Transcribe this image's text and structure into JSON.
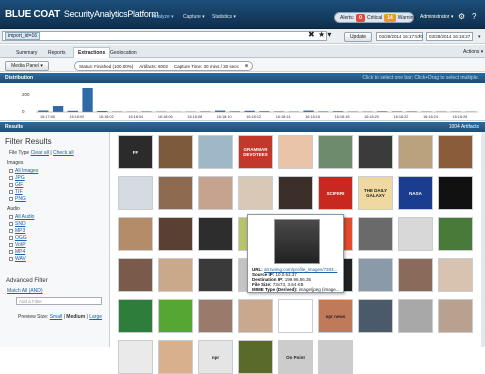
{
  "header": {
    "brand": "BLUE COAT",
    "product": "SecurityAnalyticsPlatform",
    "nav": [
      "Analyze ▾",
      "Capture ▾",
      "Statistics ▾"
    ],
    "alerts_label": "Alerts:",
    "critical_count": "0",
    "critical_label": "Critical",
    "warning_count": "14",
    "warning_label": "Warning",
    "user": "Administrator ▾",
    "critical_color": "#d94d3a",
    "warning_color": "#e79a2a"
  },
  "query": {
    "token": "import_id=16",
    "clear": "✖",
    "star": "★ ▾",
    "update_label": "Update",
    "date_from": "03/28/2014 16:17:57",
    "date_sep": "to",
    "date_to": "03/28/2014 16:18:27",
    "dd": "▾"
  },
  "tabs": [
    "Summary",
    "Reports",
    "Extractions",
    "Geolocation"
  ],
  "actions": "Actions ▾",
  "filter": {
    "media_btn": "Media Panel ▾",
    "status": "Status: Finished (100.00%)",
    "artifacts": "Artifacts: 6002",
    "capture": "Capture Time: 30 mins / 30 secs"
  },
  "distribution": {
    "title": "Distribution",
    "hint": "Click to select one bar; Click+Drag to select multiple."
  },
  "chart_data": {
    "type": "bar",
    "title": "Distribution",
    "y_ticks": [
      "200",
      "0"
    ],
    "categories": [
      "16:17:58",
      "16:18:00",
      "16:18:02",
      "16:18:04",
      "16:18:06",
      "16:18:08",
      "16:18:10",
      "16:18:12",
      "16:18:14",
      "16:18:16",
      "16:18:18",
      "16:18:20",
      "16:18:22",
      "16:18:24",
      "16:18:26"
    ],
    "values": [
      15,
      60,
      12,
      240,
      10,
      5,
      4,
      6,
      5,
      3,
      4,
      6,
      14,
      7,
      12,
      8,
      6,
      5,
      14,
      6,
      8,
      5,
      5,
      7,
      6,
      6,
      5,
      5,
      5,
      4
    ],
    "ylim": [
      0,
      250
    ],
    "bar_color": "#2f6aa6"
  },
  "results": {
    "title": "Results",
    "count": "1004 Artifacts"
  },
  "sidebar": {
    "title": "Filter Results",
    "file_type": "File Type",
    "clear_all": "Clear all",
    "check_all": "Check all",
    "sep": "|",
    "images_label": "Images",
    "images": [
      "All Images",
      "JPG",
      "GIF",
      "TIF",
      "PNG"
    ],
    "audio_label": "Audio",
    "audio": [
      "All Audio",
      "SND",
      "MP3",
      "OGG",
      "VoIP",
      "MP4",
      "WAV"
    ],
    "advanced": "Advanced Filter",
    "match_all": "Match All (AND)",
    "add_placeholder": "Add a Filter",
    "preview": "Preview Size:",
    "small": "Small",
    "medium": "Medium",
    "large": "Large"
  },
  "thumbs": [
    "FF",
    "",
    "",
    "GRAMMAR DEVOTEES",
    "",
    "",
    "",
    "",
    "",
    "",
    "",
    "",
    "",
    "",
    "SCIFERI",
    "THE DAILY GALAXY",
    "NASA",
    "",
    "",
    "",
    "",
    "",
    "",
    "",
    "",
    "",
    "",
    "",
    "",
    "",
    "",
    "",
    "",
    "",
    "",
    "",
    "",
    "",
    "",
    "",
    "",
    "npr news",
    "",
    "",
    "",
    "",
    "",
    "npr",
    "",
    "On Point",
    ""
  ],
  "thumb_colors": [
    "#2b2b2b",
    "#7d5a3c",
    "#9fb8c8",
    "#c0392b",
    "#e9c4a8",
    "#6e8b6e",
    "#3b3b3b",
    "#b9a27c",
    "#8a5c3a",
    "#d5dbe0",
    "#8e6a50",
    "#c6a38e",
    "#d9c8b5",
    "#3c2f2a",
    "#c8281e",
    "#f0d9a0",
    "#1b3d8f",
    "#111111",
    "#b58c6a",
    "#5a4032",
    "#2d2d2d",
    "#b8c36a",
    "#9aa6b2",
    "#e64a2e",
    "#6a6a6a",
    "#d8d8d8",
    "#4a7a3a",
    "#7a5a4a",
    "#c9a98a",
    "#3a3a3a",
    "#c4c4c4",
    "#c8a07a",
    "#222222",
    "#8a9aa8",
    "#8a6a5a",
    "#d8c2b0",
    "#2f7d3a",
    "#55a632",
    "#9a7a6a",
    "#c9a88e",
    "#ffffff",
    "#c07a5a",
    "#4a5a6a",
    "#a8a8a8",
    "#b8a18e",
    "#eaeaea",
    "#d9b08e",
    "#e5e5e5",
    "#5a6a2a"
  ],
  "tooltip": {
    "url_k": "URL:",
    "url_v": "a0.twimg.com/profile_images/7283...",
    "src_k": "Source IP:",
    "src_v": "10.0.63.37",
    "dst_k": "Destination IP:",
    "dst_v": "199.96.56.36",
    "size_k": "File Size:",
    "size_v": "73x73, 3.64 KB",
    "mime_k": "MIME Type (Derived):",
    "mime_v": "image/jpeg (image..."
  }
}
